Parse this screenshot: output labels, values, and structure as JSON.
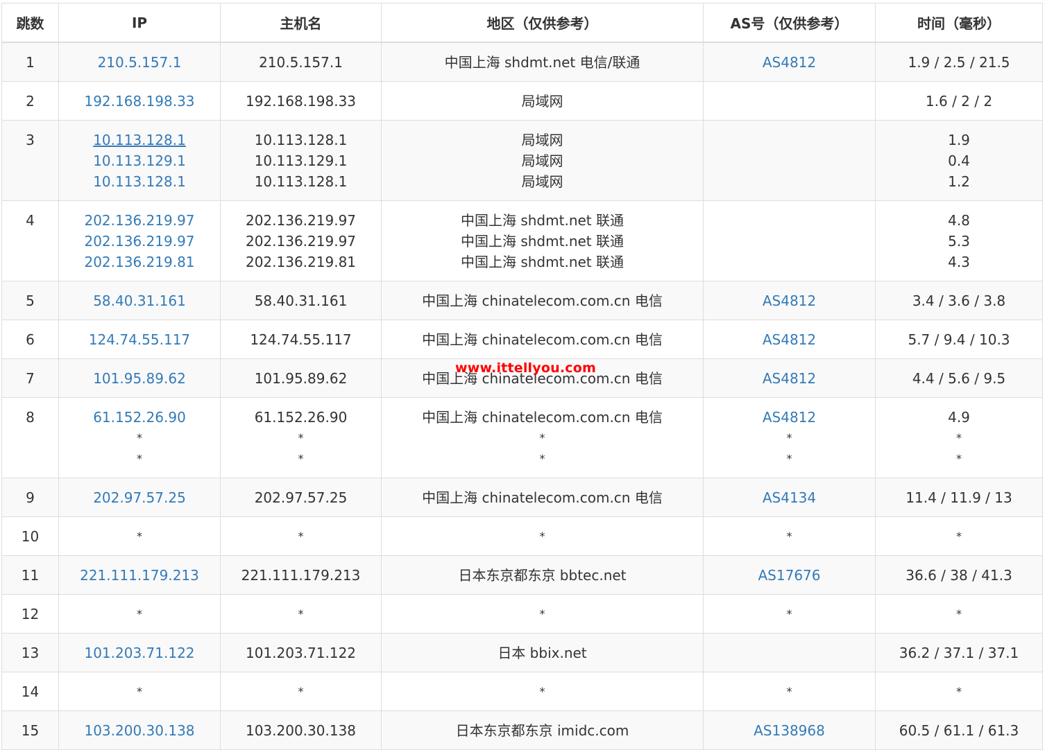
{
  "header": {
    "hop": "跳数",
    "ip": "IP",
    "host": "主机名",
    "region": "地区（仅供参考）",
    "as": "AS号（仅供参考）",
    "time": "时间（毫秒）"
  },
  "watermark": "www.ittellyou.com",
  "colors": {
    "link": "#337ab7",
    "text": "#333333",
    "border": "#dddddd",
    "stripe": "#f9f9f9",
    "watermark": "#ff0000"
  },
  "hops": [
    {
      "hop": "1",
      "lines": [
        {
          "ip": "210.5.157.1",
          "host": "210.5.157.1",
          "region": "中国上海 shdmt.net 电信/联通",
          "as": "AS4812",
          "time": "1.9 / 2.5 / 21.5"
        }
      ]
    },
    {
      "hop": "2",
      "lines": [
        {
          "ip": "192.168.198.33",
          "host": "192.168.198.33",
          "region": "局域网",
          "as": "",
          "time": "1.6 / 2 / 2"
        }
      ]
    },
    {
      "hop": "3",
      "lines": [
        {
          "ip": "10.113.128.1",
          "host": "10.113.128.1",
          "region": "局域网",
          "as": "",
          "time": "1.9"
        },
        {
          "ip": "10.113.129.1",
          "host": "10.113.129.1",
          "region": "局域网",
          "as": "",
          "time": "0.4"
        },
        {
          "ip": "10.113.128.1",
          "host": "10.113.128.1",
          "region": "局域网",
          "as": "",
          "time": "1.2"
        }
      ]
    },
    {
      "hop": "4",
      "lines": [
        {
          "ip": "202.136.219.97",
          "host": "202.136.219.97",
          "region": "中国上海 shdmt.net 联通",
          "as": "",
          "time": "4.8"
        },
        {
          "ip": "202.136.219.97",
          "host": "202.136.219.97",
          "region": "中国上海 shdmt.net 联通",
          "as": "",
          "time": "5.3"
        },
        {
          "ip": "202.136.219.81",
          "host": "202.136.219.81",
          "region": "中国上海 shdmt.net 联通",
          "as": "",
          "time": "4.3"
        }
      ]
    },
    {
      "hop": "5",
      "lines": [
        {
          "ip": "58.40.31.161",
          "host": "58.40.31.161",
          "region": "中国上海 chinatelecom.com.cn 电信",
          "as": "AS4812",
          "time": "3.4 / 3.6 / 3.8"
        }
      ]
    },
    {
      "hop": "6",
      "lines": [
        {
          "ip": "124.74.55.117",
          "host": "124.74.55.117",
          "region": "中国上海 chinatelecom.com.cn 电信",
          "as": "AS4812",
          "time": "5.7 / 9.4 / 10.3"
        }
      ]
    },
    {
      "hop": "7",
      "lines": [
        {
          "ip": "101.95.89.62",
          "host": "101.95.89.62",
          "region": "中国上海 chinatelecom.com.cn 电信",
          "as": "AS4812",
          "time": "4.4 / 5.6 / 9.5"
        }
      ]
    },
    {
      "hop": "8",
      "lines": [
        {
          "ip": "61.152.26.90",
          "host": "61.152.26.90",
          "region": "中国上海 chinatelecom.com.cn 电信",
          "as": "AS4812",
          "time": "4.9"
        },
        {
          "ip": "*",
          "host": "*",
          "region": "*",
          "as": "*",
          "time": "*"
        },
        {
          "ip": "*",
          "host": "*",
          "region": "*",
          "as": "*",
          "time": "*"
        }
      ]
    },
    {
      "hop": "9",
      "lines": [
        {
          "ip": "202.97.57.25",
          "host": "202.97.57.25",
          "region": "中国上海 chinatelecom.com.cn 电信",
          "as": "AS4134",
          "time": "11.4 / 11.9 / 13"
        }
      ]
    },
    {
      "hop": "10",
      "lines": [
        {
          "ip": "*",
          "host": "*",
          "region": "*",
          "as": "*",
          "time": "*"
        }
      ]
    },
    {
      "hop": "11",
      "lines": [
        {
          "ip": "221.111.179.213",
          "host": "221.111.179.213",
          "region": "日本东京都东京 bbtec.net",
          "as": "AS17676",
          "time": "36.6 / 38 / 41.3"
        }
      ]
    },
    {
      "hop": "12",
      "lines": [
        {
          "ip": "*",
          "host": "*",
          "region": "*",
          "as": "*",
          "time": "*"
        }
      ]
    },
    {
      "hop": "13",
      "lines": [
        {
          "ip": "101.203.71.122",
          "host": "101.203.71.122",
          "region": "日本 bbix.net",
          "as": "",
          "time": "36.2 / 37.1 / 37.1"
        }
      ]
    },
    {
      "hop": "14",
      "lines": [
        {
          "ip": "*",
          "host": "*",
          "region": "*",
          "as": "*",
          "time": "*"
        }
      ]
    },
    {
      "hop": "15",
      "lines": [
        {
          "ip": "103.200.30.138",
          "host": "103.200.30.138",
          "region": "日本东京都东京 imidc.com",
          "as": "AS138968",
          "time": "60.5 / 61.1 / 61.3"
        }
      ]
    }
  ]
}
